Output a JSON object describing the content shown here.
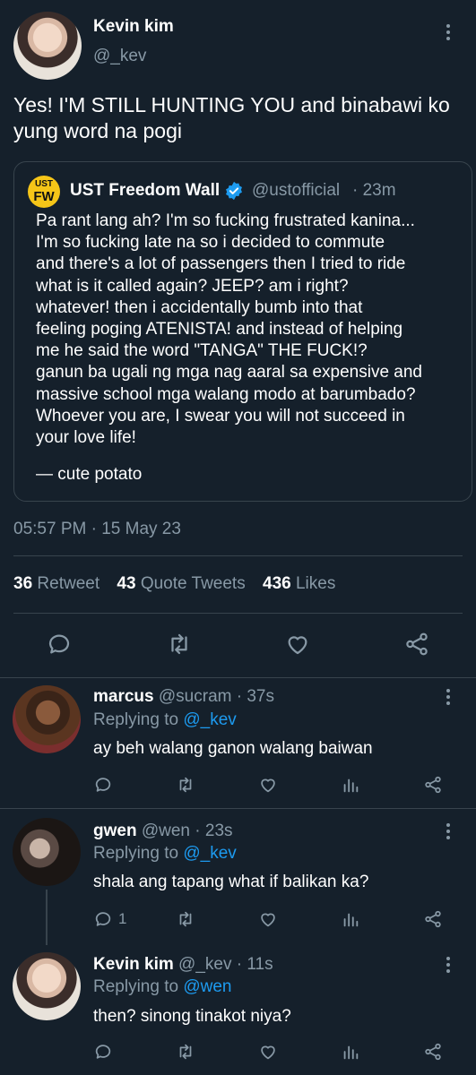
{
  "tweet": {
    "author_name": "Kevin kim",
    "author_handle": "@_kev",
    "text": "Yes! I'M STILL HUNTING YOU and binabawi ko yung word na pogi",
    "timestamp": "05:57 PM · 15 May 23"
  },
  "quoted": {
    "avatar_text_top": "UST",
    "avatar_text_bottom": "FW",
    "name": "UST Freedom Wall",
    "handle": "@ustofficial",
    "age": "· 23m",
    "text": "Pa rant lang ah? I'm so fucking frustrated kanina...\nI'm so fucking late na so i decided to commute\nand there's a lot of passengers then I tried to ride\nwhat is it called again? JEEP? am i right?\nwhatever! then i accidentally bumb into that\nfeeling poging ATENISTA! and instead of helping\nme he said the word \"TANGA\" THE FUCK!?\nganun ba ugali ng mga nag aaral sa expensive and\nmassive school mga walang modo at barumbado?\nWhoever you are, I swear you will not succeed in\nyour love life!",
    "signature": "— cute potato"
  },
  "stats": {
    "retweets": "36",
    "retweets_label": "Retweet",
    "quotes": "43",
    "quotes_label": "Quote Tweets",
    "likes": "436",
    "likes_label": "Likes"
  },
  "replies": [
    {
      "name": "marcus",
      "handle": "@sucram",
      "age": "· 37s",
      "replying_prefix": "Replying to",
      "replying_to": "@_kev",
      "text": "ay beh walang ganon walang baiwan",
      "reply_count": ""
    },
    {
      "name": "gwen",
      "handle": "@wen",
      "age": "· 23s",
      "replying_prefix": "Replying to",
      "replying_to": "@_kev",
      "text": "shala ang tapang what if balikan ka?",
      "reply_count": "1"
    },
    {
      "name": "Kevin kim",
      "handle": "@_kev",
      "age": "· 11s",
      "replying_prefix": "Replying to",
      "replying_to": "@wen",
      "text": "then? sinong tinakot niya?",
      "reply_count": ""
    }
  ],
  "icons": [
    "more-icon",
    "verified-badge-icon",
    "reply-icon",
    "retweet-icon",
    "like-icon",
    "share-icon",
    "analytics-icon"
  ],
  "colors": {
    "background": "#15202b",
    "muted": "#8899a6",
    "link": "#1d9bf0",
    "divider": "#38444d"
  }
}
